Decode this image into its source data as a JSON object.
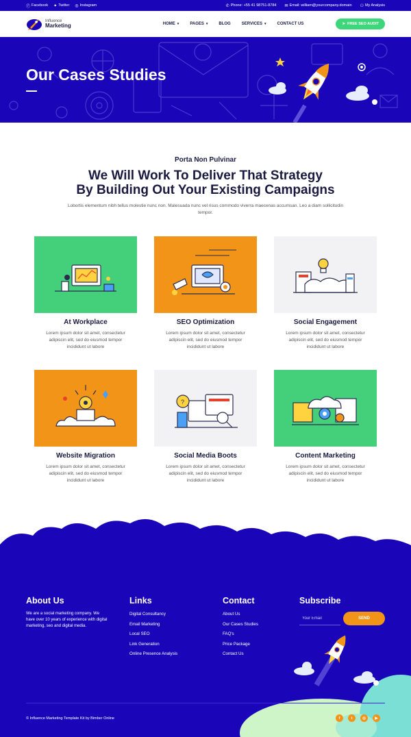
{
  "topbar": {
    "links": [
      {
        "icon": "facebook-icon",
        "label": "Facebook"
      },
      {
        "icon": "twitter-icon",
        "label": "Twitter"
      },
      {
        "icon": "instagram-icon",
        "label": "Instagram"
      }
    ],
    "phone": "Phone: +55 41 98751-8784",
    "email": "Email: william@yourcompany.domain",
    "account": "My Analysis"
  },
  "header": {
    "logo_line1": "Influence",
    "logo_line2": "Marketing",
    "nav": [
      {
        "label": "HOME",
        "dropdown": true
      },
      {
        "label": "PAGES",
        "dropdown": true
      },
      {
        "label": "BLOG",
        "dropdown": false
      },
      {
        "label": "SERVICES",
        "dropdown": true
      },
      {
        "label": "CONTACT US",
        "dropdown": false
      }
    ],
    "cta": "FREE SEO AUDIT"
  },
  "hero": {
    "title": "Our Cases Studies"
  },
  "intro": {
    "eyebrow": "Porta Non Pulvinar",
    "headline_line1": "We Will Work To Deliver That Strategy",
    "headline_line2": "By Building Out Your Existing Campaigns",
    "lead": "Lobortis elementum nibh tellus molestie nunc non. Malesuada nunc vel risus commodo viverra maecenas accumsan. Leo a diam sollicitudin tempor."
  },
  "cases": [
    {
      "title": "At Workplace",
      "desc": "Lorem ipsum dolor sit amet, consectetur adipiscin elit, sed do eiusmod tempor incididunt ut labore",
      "bg": "green"
    },
    {
      "title": "SEO Optimization",
      "desc": "Lorem ipsum dolor sit amet, consectetur adipiscin elit, sed do eiusmod tempor incididunt ut labore",
      "bg": "orange"
    },
    {
      "title": "Social Engagement",
      "desc": "Lorem ipsum dolor sit amet, consectetur adipiscin elit, sed do eiusmod tempor incididunt ut labore",
      "bg": "grey"
    },
    {
      "title": "Website Migration",
      "desc": "Lorem ipsum dolor sit amet, consectetur adipiscin elit, sed do eiusmod tempor incididunt ut labore",
      "bg": "orange"
    },
    {
      "title": "Social Media Boots",
      "desc": "Lorem ipsum dolor sit amet, consectetur adipiscin elit, sed do eiusmod tempor incididunt ut labore",
      "bg": "grey"
    },
    {
      "title": "Content Marketing",
      "desc": "Lorem ipsum dolor sit amet, consectetur adipiscin elit, sed do eiusmod tempor incididunt ut labore",
      "bg": "green"
    }
  ],
  "footer": {
    "about_title": "About Us",
    "about_text": "We are a social marketing company. We have over 10 years of experience with digital marketing, seo and digital media.",
    "links_title": "Links",
    "links": [
      "Digital Consultancy",
      "Email Marketing",
      "Local SEO",
      "Link Generation",
      "Online Presence Analysis"
    ],
    "contact_title": "Contact",
    "contact_links": [
      "About Us",
      "Our Cases Studies",
      "FAQ's",
      "Price Package",
      "Contact Us"
    ],
    "subscribe_title": "Subscribe",
    "email_placeholder": "Your Email",
    "send_label": "SEND",
    "copyright": "© Influence Marketing Template Kit by Bimber Online",
    "social_icons": [
      "facebook-icon",
      "twitter-icon",
      "instagram-icon",
      "youtube-icon"
    ]
  },
  "colors": {
    "brand_blue": "#1a06b8",
    "accent_green": "#3ed67a",
    "accent_orange": "#f29418"
  }
}
